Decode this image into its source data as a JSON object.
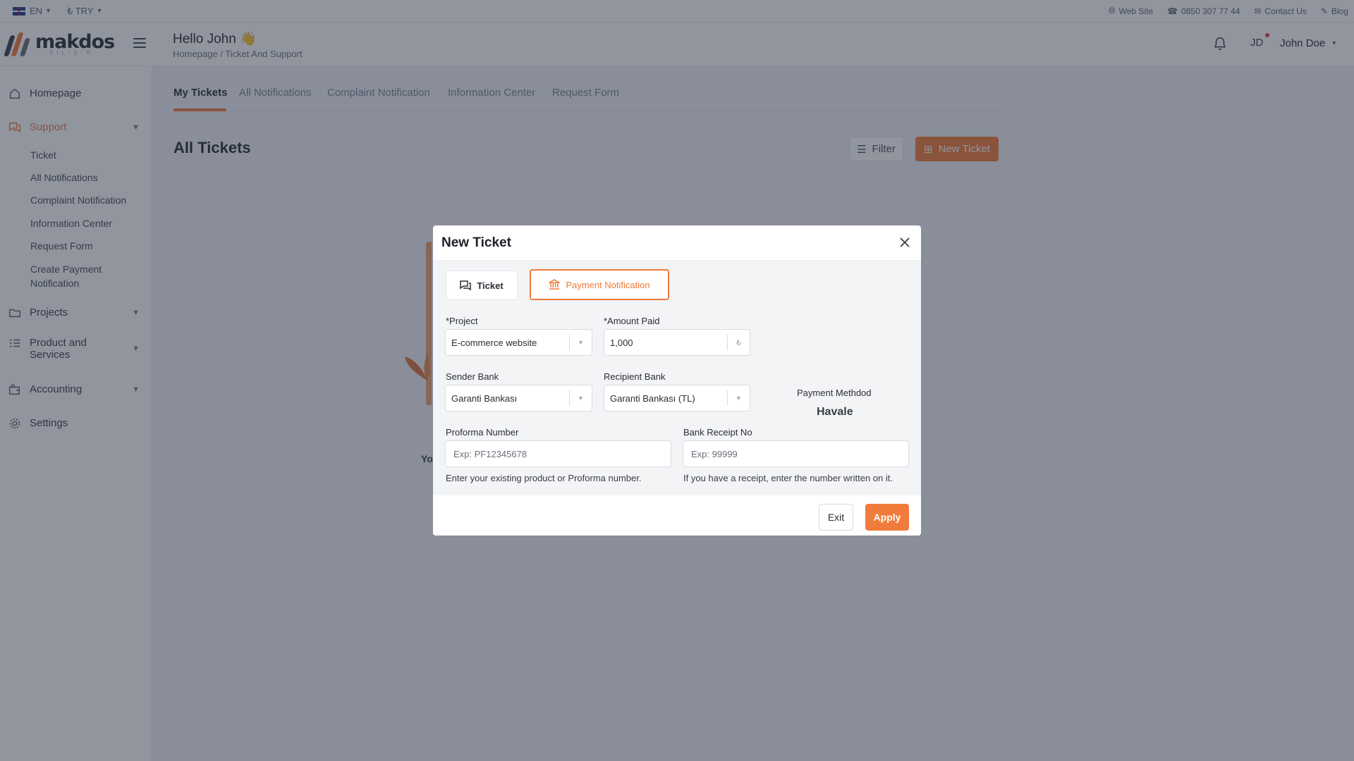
{
  "topbar": {
    "language": "EN",
    "currency": "₺ TRY",
    "links": {
      "website": "Web Site",
      "phone": "0850 307 77 44",
      "contact": "Contact Us",
      "blog": "Blog"
    }
  },
  "header": {
    "logo_text": "makdos",
    "logo_sub": "BILIŞIM",
    "greeting": "Hello John 👋",
    "breadcrumb": "Homepage / Ticket And Support",
    "avatar_initials": "JD",
    "user_name": "John Doe"
  },
  "sidebar": {
    "items": [
      {
        "label": "Homepage"
      },
      {
        "label": "Support"
      },
      {
        "label": "Projects"
      },
      {
        "label": "Product and Services"
      },
      {
        "label": "Accounting"
      },
      {
        "label": "Settings"
      }
    ],
    "support_sub": [
      {
        "label": "Ticket"
      },
      {
        "label": "All Notifications"
      },
      {
        "label": "Complaint Notification"
      },
      {
        "label": "Information Center"
      },
      {
        "label": "Request Form"
      },
      {
        "label": "Create Payment Notification"
      }
    ]
  },
  "main": {
    "tabs": [
      {
        "label": "My Tickets"
      },
      {
        "label": "All Notifications"
      },
      {
        "label": "Complaint Notification"
      },
      {
        "label": "Information Center"
      },
      {
        "label": "Request Form"
      }
    ],
    "page_title": "All Tickets",
    "filter_label": "Filter",
    "new_ticket_label": "New Ticket",
    "empty_text_partial": "Yo"
  },
  "modal": {
    "title": "New Ticket",
    "type_ticket": "Ticket",
    "type_payment": "Payment Notification",
    "project_label": "*Project",
    "project_value": "E-commerce website",
    "amount_label": "*Amount Paid",
    "amount_value": "1,000",
    "amount_currency": "₺",
    "sender_bank_label": "Sender Bank",
    "sender_bank_value": "Garanti Bankası",
    "recipient_bank_label": "Recipient Bank",
    "recipient_bank_value": "Garanti Bankası (TL)",
    "payment_method_label": "Payment Methdod",
    "payment_method_value": "Havale",
    "proforma_label": "Proforma Number",
    "proforma_placeholder": "Exp: PF12345678",
    "proforma_help": "Enter your existing product or Proforma number.",
    "receipt_label": "Bank Receipt No",
    "receipt_placeholder": "Exp: 99999",
    "receipt_help": "If you have a receipt, enter the number written on it.",
    "exit_label": "Exit",
    "apply_label": "Apply"
  },
  "colors": {
    "accent": "#f07b3a",
    "overlay": "rgba(36,44,62,0.5)"
  }
}
